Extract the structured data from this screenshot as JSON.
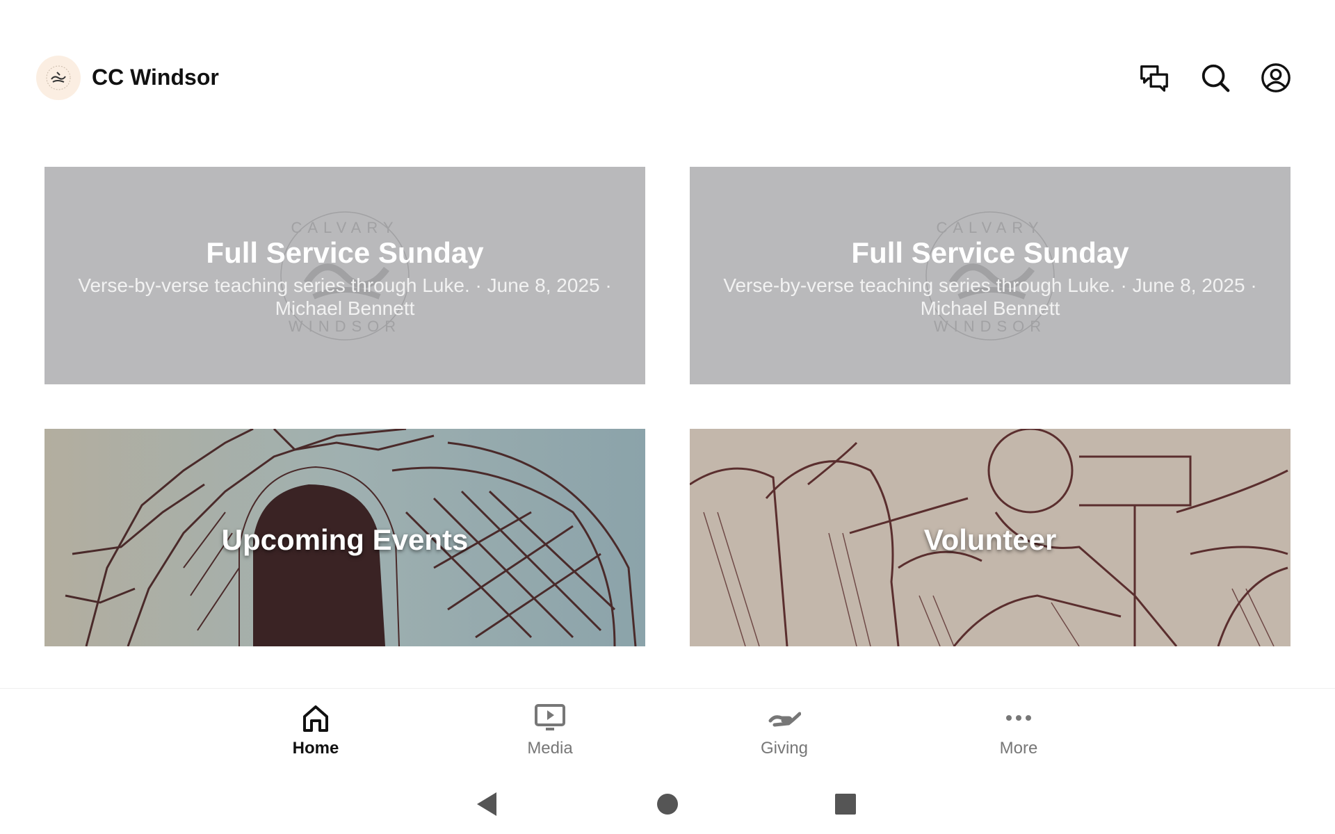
{
  "header": {
    "app_title": "CC Windsor",
    "logo_icon": "church-logo-icon",
    "icons": [
      "chat-icon",
      "search-icon",
      "account-icon"
    ]
  },
  "cards": [
    {
      "title": "Full Service Sunday",
      "subtitle": "Verse-by-verse teaching series through Luke. · June 8, 2025 · Michael Bennett",
      "watermark_top": "CALVARY",
      "watermark_bottom": "WINDSOR"
    },
    {
      "title": "Full Service Sunday",
      "subtitle": "Verse-by-verse teaching series through Luke. · June 8, 2025 · Michael Bennett",
      "watermark_top": "CALVARY",
      "watermark_bottom": "WINDSOR"
    },
    {
      "title": "Upcoming Events"
    },
    {
      "title": "Volunteer"
    }
  ],
  "bottom_nav": {
    "items": [
      {
        "label": "Home",
        "icon": "home-icon",
        "active": true
      },
      {
        "label": "Media",
        "icon": "media-icon",
        "active": false
      },
      {
        "label": "Giving",
        "icon": "giving-icon",
        "active": false
      },
      {
        "label": "More",
        "icon": "more-icon",
        "active": false
      }
    ]
  },
  "system_nav": [
    "back-icon",
    "home-circle-icon",
    "recents-icon"
  ],
  "colors": {
    "card_gray": "#b9b9bb",
    "events_tint": "#8fa7ac",
    "volunteer_tint": "#c5b79f",
    "art_ink": "#4a2a2a"
  }
}
